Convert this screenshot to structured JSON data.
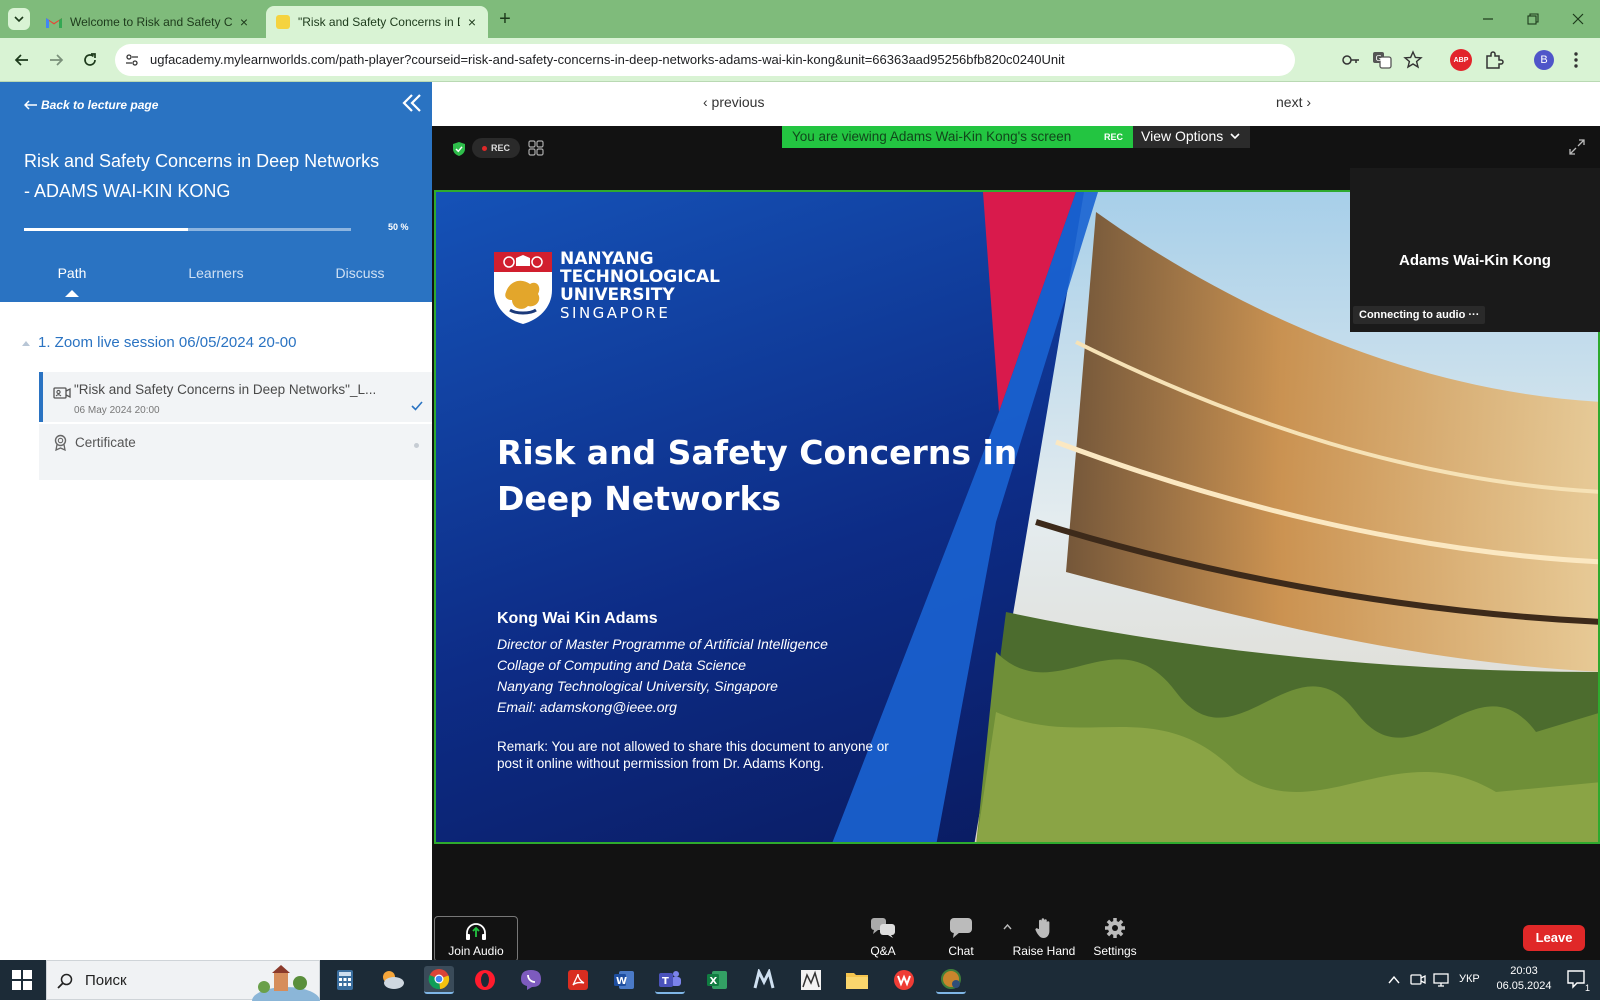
{
  "browser": {
    "tabs": [
      {
        "title": "Welcome to Risk and Safety Co",
        "favicon": "gmail-icon",
        "active": false
      },
      {
        "title": "\"Risk and Safety Concerns in De",
        "favicon": "learnworlds-icon",
        "active": true
      }
    ],
    "url": "ugfacademy.mylearnworlds.com/path-player?courseid=risk-and-safety-concerns-in-deep-networks-adams-wai-kin-kong&unit=66363aad95256bfb820c0240Unit",
    "profile_initial": "B",
    "abp_label": "ABP",
    "colors": {
      "frame": "#7fbb7b",
      "toolbar": "#d9f3d4"
    }
  },
  "sidebar": {
    "back_label": "Back to lecture page",
    "course_title_line1": "Risk and Safety Concerns in Deep Networks",
    "course_title_line2": "- ADAMS WAI-KIN KONG",
    "progress_percent": 50,
    "progress_label": "50 %",
    "tabs": [
      {
        "label": "Path",
        "active": true
      },
      {
        "label": "Learners",
        "active": false
      },
      {
        "label": "Discuss",
        "active": false
      }
    ],
    "section_title": "1. Zoom live session 06/05/2024 20-00",
    "items": [
      {
        "label": "\"Risk and Safety Concerns in Deep Networks\"_L...",
        "date": "06 May 2024 20:00",
        "completed": true,
        "icon": "video-icon"
      },
      {
        "label": "Certificate",
        "completed": false,
        "icon": "certificate-icon"
      }
    ],
    "colors": {
      "header": "#2a73c2",
      "accent": "#2a73c2"
    }
  },
  "content_nav": {
    "previous": "‹ previous",
    "next": "next ›"
  },
  "zoom": {
    "rec_label": "REC",
    "viewing_banner": "You are viewing Adams Wai-Kin Kong's screen",
    "banner_rec": "REC",
    "view_options": "View Options",
    "participant_name": "Adams Wai-Kin Kong",
    "audio_status": "Connecting to audio ···",
    "toolbar": {
      "join_audio": "Join Audio",
      "qa": "Q&A",
      "chat": "Chat",
      "raise_hand": "Raise Hand",
      "settings": "Settings",
      "leave": "Leave"
    },
    "colors": {
      "banner": "#23c541",
      "leave": "#e02828",
      "share_border": "#2eaa2e"
    }
  },
  "slide": {
    "logo_line1": "NANYANG",
    "logo_line2": "TECHNOLOGICAL",
    "logo_line3": "UNIVERSITY",
    "logo_line4": "SINGAPORE",
    "title_line1": "Risk and Safety Concerns in",
    "title_line2": "Deep Networks",
    "author": "Kong Wai Kin Adams",
    "details": [
      "Director of Master Programme of Artificial Intelligence",
      "Collage of Computing and Data Science",
      "Nanyang Technological University, Singapore",
      "Email: adamskong@ieee.org"
    ],
    "remark_line1": "Remark: You are not allowed to share this document to anyone or",
    "remark_line2": "post it online without permission from Dr. Adams Kong."
  },
  "taskbar": {
    "search_placeholder": "Поиск",
    "language": "УКР",
    "time": "20:03",
    "date": "06.05.2024",
    "notification_count": "1"
  }
}
